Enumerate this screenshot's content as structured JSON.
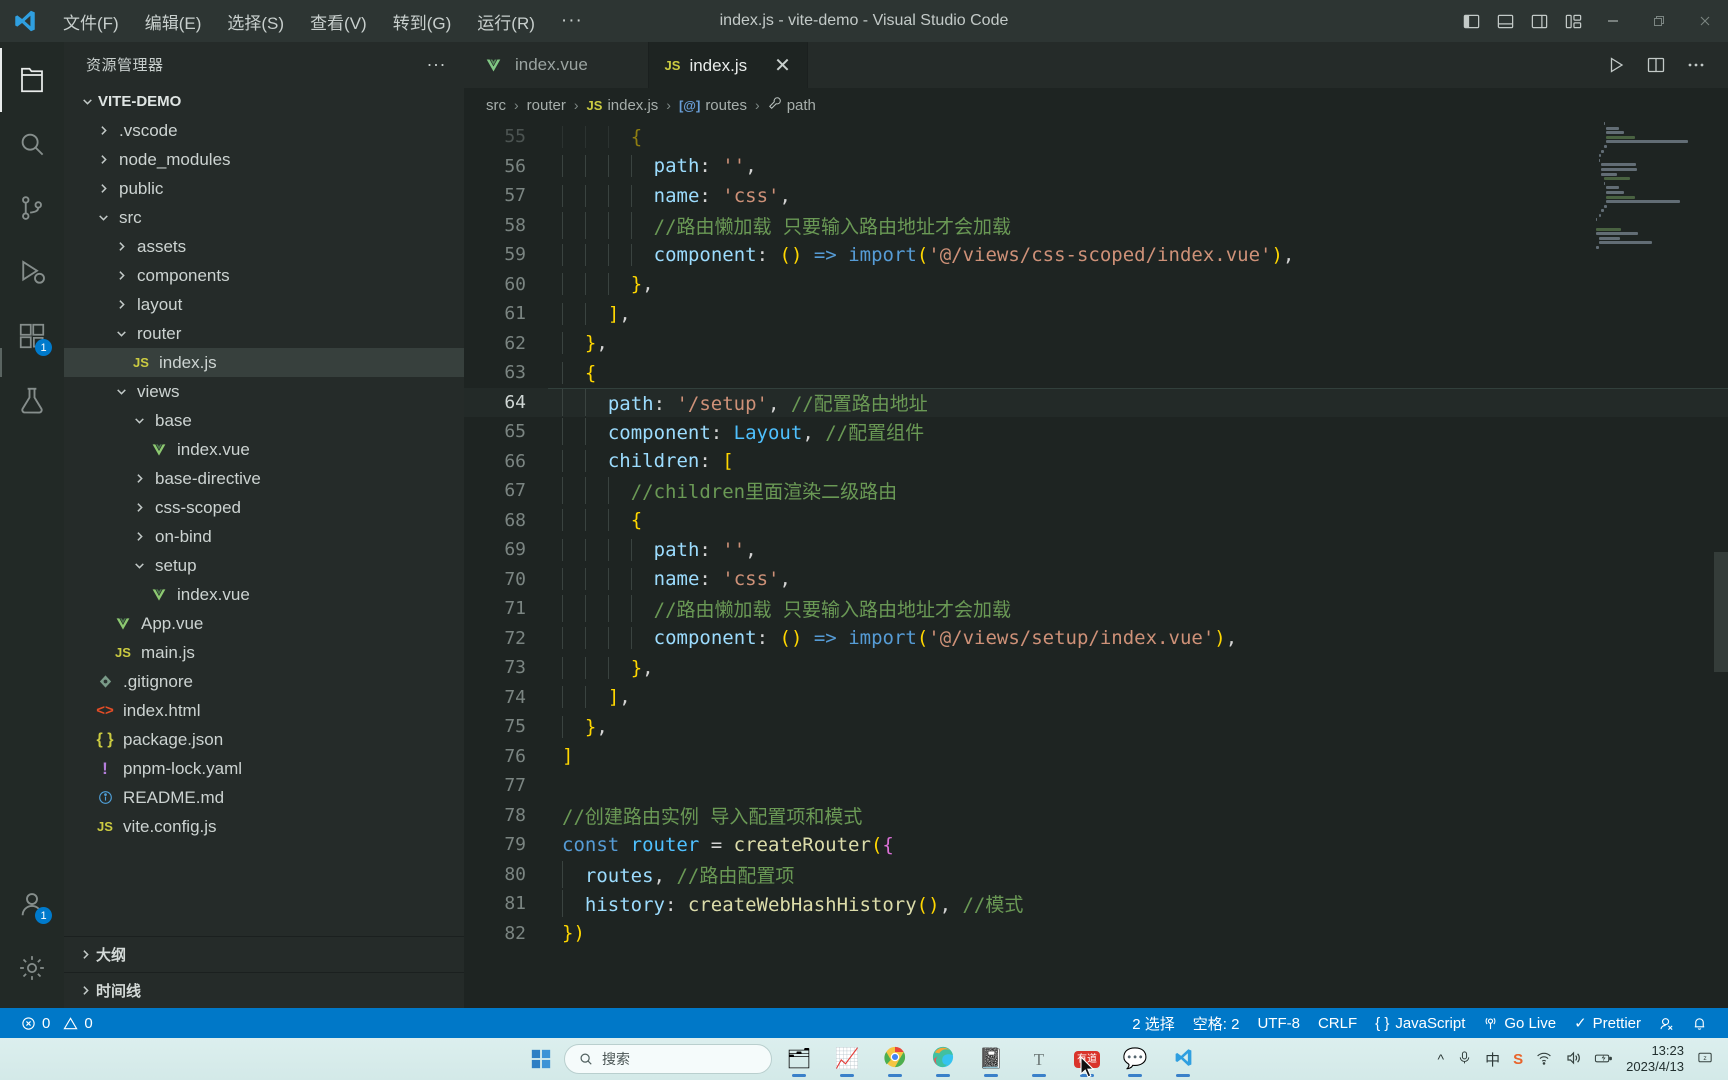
{
  "titlebar": {
    "window_title": "index.js - vite-demo - Visual Studio Code",
    "menus": [
      "文件(F)",
      "编辑(E)",
      "选择(S)",
      "查看(V)",
      "转到(G)",
      "运行(R)"
    ],
    "more_label": "···",
    "layout_buttons": [
      "toggle-primary-sidebar",
      "toggle-panel",
      "toggle-secondary-sidebar",
      "customize-layout"
    ],
    "window_controls": [
      "minimize",
      "restore",
      "close"
    ]
  },
  "activitybar": {
    "items": [
      {
        "name": "explorer",
        "active": true,
        "badge": ""
      },
      {
        "name": "search",
        "active": false,
        "badge": ""
      },
      {
        "name": "source-control",
        "active": false,
        "badge": ""
      },
      {
        "name": "run-and-debug",
        "active": false,
        "badge": ""
      },
      {
        "name": "extensions",
        "active": false,
        "badge": "1"
      },
      {
        "name": "testing",
        "active": false,
        "badge": ""
      }
    ],
    "bottom": [
      {
        "name": "accounts",
        "badge": "1"
      },
      {
        "name": "manage-settings",
        "badge": ""
      }
    ]
  },
  "sidebar": {
    "title": "资源管理器",
    "more_label": "···",
    "root": "VITE-DEMO",
    "tree": [
      {
        "label": ".vscode",
        "depth": 1,
        "type": "folder",
        "state": "collapsed"
      },
      {
        "label": "node_modules",
        "depth": 1,
        "type": "folder",
        "state": "collapsed"
      },
      {
        "label": "public",
        "depth": 1,
        "type": "folder",
        "state": "collapsed"
      },
      {
        "label": "src",
        "depth": 1,
        "type": "folder",
        "state": "expanded"
      },
      {
        "label": "assets",
        "depth": 2,
        "type": "folder",
        "state": "collapsed"
      },
      {
        "label": "components",
        "depth": 2,
        "type": "folder",
        "state": "collapsed"
      },
      {
        "label": "layout",
        "depth": 2,
        "type": "folder",
        "state": "collapsed"
      },
      {
        "label": "router",
        "depth": 2,
        "type": "folder",
        "state": "expanded"
      },
      {
        "label": "index.js",
        "depth": 3,
        "type": "js",
        "state": "file",
        "selected": true
      },
      {
        "label": "views",
        "depth": 2,
        "type": "folder",
        "state": "expanded"
      },
      {
        "label": "base",
        "depth": 3,
        "type": "folder",
        "state": "expanded"
      },
      {
        "label": "index.vue",
        "depth": 4,
        "type": "vue",
        "state": "file"
      },
      {
        "label": "base-directive",
        "depth": 3,
        "type": "folder",
        "state": "collapsed"
      },
      {
        "label": "css-scoped",
        "depth": 3,
        "type": "folder",
        "state": "collapsed"
      },
      {
        "label": "on-bind",
        "depth": 3,
        "type": "folder",
        "state": "collapsed"
      },
      {
        "label": "setup",
        "depth": 3,
        "type": "folder",
        "state": "expanded"
      },
      {
        "label": "index.vue",
        "depth": 4,
        "type": "vue",
        "state": "file"
      },
      {
        "label": "App.vue",
        "depth": 2,
        "type": "vue",
        "state": "file"
      },
      {
        "label": "main.js",
        "depth": 2,
        "type": "js",
        "state": "file"
      },
      {
        "label": ".gitignore",
        "depth": 1,
        "type": "git",
        "state": "file"
      },
      {
        "label": "index.html",
        "depth": 1,
        "type": "html",
        "state": "file"
      },
      {
        "label": "package.json",
        "depth": 1,
        "type": "json",
        "state": "file"
      },
      {
        "label": "pnpm-lock.yaml",
        "depth": 1,
        "type": "yaml",
        "state": "file"
      },
      {
        "label": "README.md",
        "depth": 1,
        "type": "md",
        "state": "file"
      },
      {
        "label": "vite.config.js",
        "depth": 1,
        "type": "js",
        "state": "file"
      }
    ],
    "sections": [
      "大纲",
      "时间线"
    ]
  },
  "editor": {
    "tabs": [
      {
        "label": "index.vue",
        "icon": "vue",
        "active": false
      },
      {
        "label": "index.js",
        "icon": "js",
        "active": true
      }
    ],
    "tab_close_label": "✕",
    "actions": [
      "run-code",
      "split-editor-right",
      "more-actions"
    ],
    "breadcrumb": [
      "src",
      "router",
      "index.js",
      "routes",
      "path"
    ],
    "breadcrumb_separator": "›",
    "first_visible_line": 55,
    "current_line": 64,
    "lines": [
      {
        "n": 55,
        "text": "      {",
        "partial": true
      },
      {
        "n": 56,
        "text": "        path: '',"
      },
      {
        "n": 57,
        "text": "        name: 'css',"
      },
      {
        "n": 58,
        "text": "        //路由懒加载 只要输入路由地址才会加载"
      },
      {
        "n": 59,
        "text": "        component: () => import('@/views/css-scoped/index.vue'),"
      },
      {
        "n": 60,
        "text": "      },"
      },
      {
        "n": 61,
        "text": "    ],"
      },
      {
        "n": 62,
        "text": "  },"
      },
      {
        "n": 63,
        "text": "  {"
      },
      {
        "n": 64,
        "text": "    path: '/setup', //配置路由地址"
      },
      {
        "n": 65,
        "text": "    component: Layout, //配置组件"
      },
      {
        "n": 66,
        "text": "    children: ["
      },
      {
        "n": 67,
        "text": "      //children里面渲染二级路由"
      },
      {
        "n": 68,
        "text": "      {"
      },
      {
        "n": 69,
        "text": "        path: '',"
      },
      {
        "n": 70,
        "text": "        name: 'css',"
      },
      {
        "n": 71,
        "text": "        //路由懒加载 只要输入路由地址才会加载"
      },
      {
        "n": 72,
        "text": "        component: () => import('@/views/setup/index.vue'),"
      },
      {
        "n": 73,
        "text": "      },"
      },
      {
        "n": 74,
        "text": "    ],"
      },
      {
        "n": 75,
        "text": "  },"
      },
      {
        "n": 76,
        "text": "]"
      },
      {
        "n": 77,
        "text": ""
      },
      {
        "n": 78,
        "text": "//创建路由实例 导入配置项和模式"
      },
      {
        "n": 79,
        "text": "const router = createRouter({"
      },
      {
        "n": 80,
        "text": "  routes, //路由配置项"
      },
      {
        "n": 81,
        "text": "  history: createWebHashHistory(), //模式"
      },
      {
        "n": 82,
        "text": "})"
      }
    ]
  },
  "statusbar": {
    "errors": "0",
    "warnings": "0",
    "selection": "2 选择",
    "indentation": "空格: 2",
    "encoding": "UTF-8",
    "eol": "CRLF",
    "language": "JavaScript",
    "golive": "Go Live",
    "formatter": "Prettier",
    "formatter_check": "✓",
    "remote_label": "",
    "bell_label": "",
    "accent": "#0078c8"
  },
  "taskbar": {
    "search_placeholder": "搜索",
    "apps": [
      {
        "name": "file-explorer",
        "glyph": "📁",
        "active": true
      },
      {
        "name": "charts-app",
        "glyph": "📊",
        "active": true
      },
      {
        "name": "google-chrome",
        "glyph": "◉",
        "active": true
      },
      {
        "name": "microsoft-edge",
        "glyph": "◉",
        "active": true
      },
      {
        "name": "notepad",
        "glyph": "📋",
        "active": true
      },
      {
        "name": "typora",
        "glyph": "T",
        "active": true
      },
      {
        "name": "youdao",
        "glyph": "有道",
        "active": true
      },
      {
        "name": "wechat",
        "glyph": "💬",
        "active": true
      },
      {
        "name": "vscode",
        "glyph": "◣",
        "active": true
      }
    ],
    "tray": [
      "chevron-up",
      "microphone",
      "ime-chinese",
      "sogou-input",
      "wifi",
      "volume",
      "battery"
    ],
    "time": "13:23",
    "date": "2023/4/13"
  }
}
